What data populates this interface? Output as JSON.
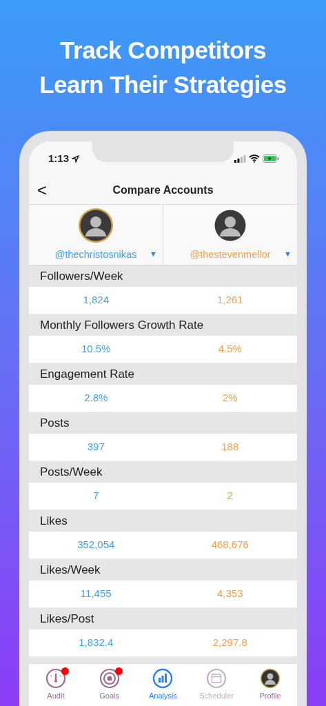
{
  "headline": [
    "Track Competitors",
    "Learn Their Strategies"
  ],
  "status_bar": {
    "time": "1:13"
  },
  "nav": {
    "back": "<",
    "title": "Compare Accounts"
  },
  "accounts": [
    {
      "handle": "@thechristosnikas",
      "color": "#3fa2ea",
      "ring": true,
      "dropdown": "▼"
    },
    {
      "handle": "@thestevenmellor",
      "color": "#f6a04d",
      "ring": false,
      "dropdown": "▼"
    }
  ],
  "metrics": [
    {
      "label": "Followers/Week",
      "values": [
        "1,824",
        "1,261"
      ]
    },
    {
      "label": "Monthly Followers Growth Rate",
      "values": [
        "10.5%",
        "4.5%"
      ]
    },
    {
      "label": "Engagement Rate",
      "values": [
        "2.8%",
        "2%"
      ]
    },
    {
      "label": "Posts",
      "values": [
        "397",
        "188"
      ]
    },
    {
      "label": "Posts/Week",
      "values": [
        "7",
        "2"
      ]
    },
    {
      "label": "Likes",
      "values": [
        "352,054",
        "468,676"
      ]
    },
    {
      "label": "Likes/Week",
      "values": [
        "11,455",
        "4,353"
      ]
    },
    {
      "label": "Likes/Post",
      "values": [
        "1,832.4",
        "2,297.8"
      ]
    }
  ],
  "tabs": [
    {
      "kind": "gauge",
      "label": "Audit",
      "selected": false,
      "disabled": false,
      "badge": true
    },
    {
      "kind": "target",
      "label": "Goals",
      "selected": false,
      "disabled": false,
      "badge": true
    },
    {
      "kind": "chart",
      "label": "Analysis",
      "selected": true,
      "disabled": false,
      "badge": false
    },
    {
      "kind": "calendar",
      "label": "Scheduler",
      "selected": false,
      "disabled": true,
      "badge": false
    },
    {
      "kind": "avatar",
      "label": "Profile",
      "selected": false,
      "disabled": false,
      "badge": false
    }
  ]
}
